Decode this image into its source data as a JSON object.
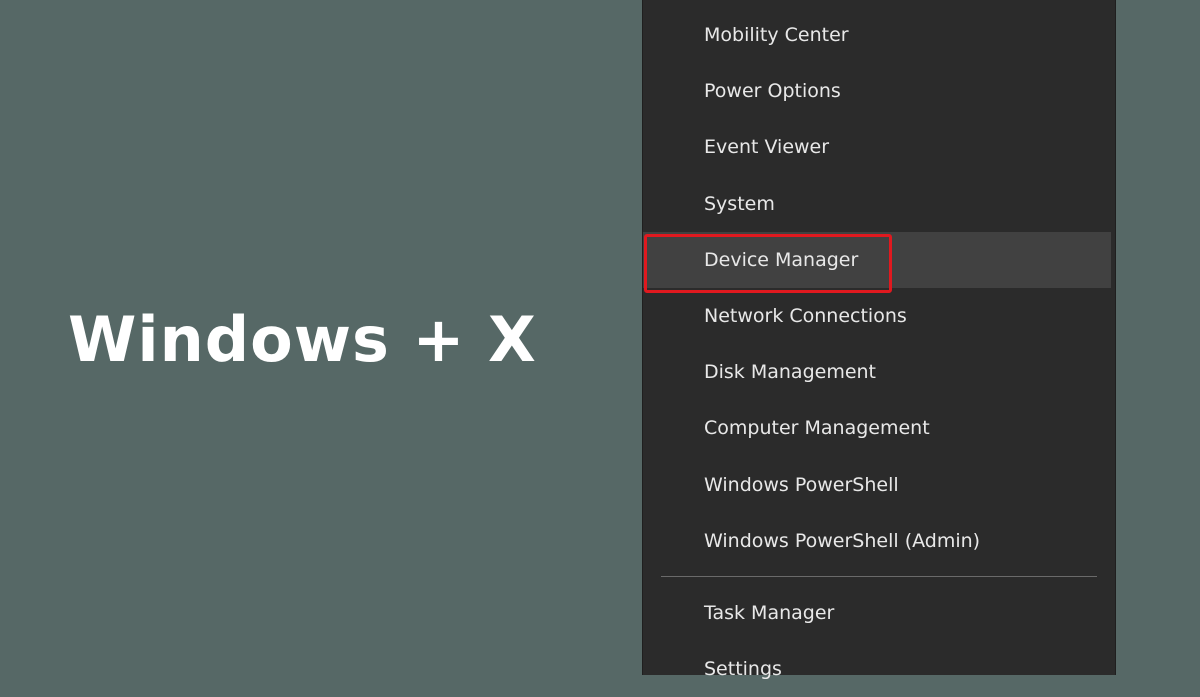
{
  "overlay": {
    "shortcut": "Windows + X"
  },
  "menu": {
    "items_top": [
      {
        "label": "Mobility Center"
      },
      {
        "label": "Power Options"
      },
      {
        "label": "Event Viewer"
      },
      {
        "label": "System"
      },
      {
        "label": "Device Manager",
        "hovered": true,
        "highlighted": true
      },
      {
        "label": "Network Connections"
      },
      {
        "label": "Disk Management"
      },
      {
        "label": "Computer Management"
      },
      {
        "label": "Windows PowerShell"
      },
      {
        "label": "Windows PowerShell (Admin)"
      }
    ],
    "items_bottom": [
      {
        "label": "Task Manager"
      },
      {
        "label": "Settings"
      }
    ]
  },
  "colors": {
    "background": "#566866",
    "menu_background": "#2b2b2b",
    "menu_hover": "#414141",
    "highlight_border": "#e0191f",
    "menu_text": "#e8e8e8"
  }
}
